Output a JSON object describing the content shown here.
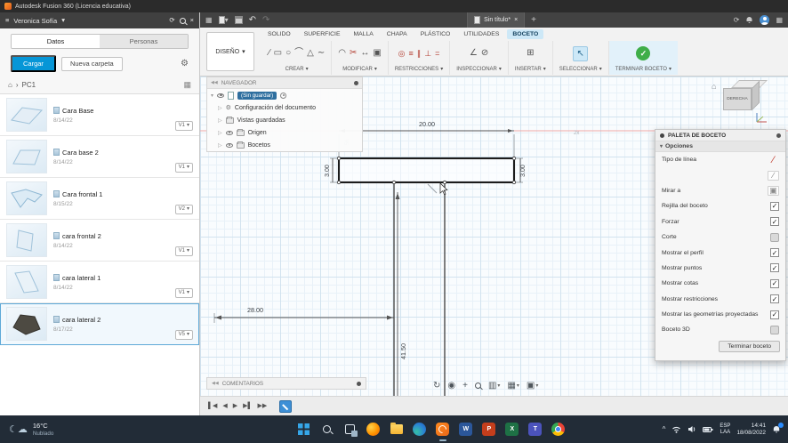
{
  "glyphs": {
    "caret_down": "▾",
    "expand": "▷",
    "collapse": "▾",
    "menu": "≡",
    "refresh": "⟳",
    "gear": "⚙",
    "home": "⌂",
    "chevron_right": "›",
    "close": "×",
    "plus": "+",
    "undo": "↶",
    "redo": "↷",
    "check": "✓",
    "grid": "▦",
    "collapse_panel": "«",
    "chevron_up": "^",
    "back2": "◀◀"
  },
  "title_bar": {
    "title": "Autodesk Fusion 360 (Licencia educativa)"
  },
  "data_panel": {
    "user": "Veronica Sofía",
    "tabs": [
      {
        "label": "Datos"
      },
      {
        "label": "Personas"
      }
    ],
    "upload_button": "Cargar",
    "new_folder_button": "Nueva carpeta",
    "breadcrumb_root": "PC1",
    "items": [
      {
        "name": "Cara Base",
        "date": "8/14/22",
        "version": "V1"
      },
      {
        "name": "Cara base 2",
        "date": "8/14/22",
        "version": "V1"
      },
      {
        "name": "Cara frontal 1",
        "date": "8/15/22",
        "version": "V2"
      },
      {
        "name": "cara frontal 2",
        "date": "8/14/22",
        "version": "V1"
      },
      {
        "name": "cara lateral 1",
        "date": "8/14/22",
        "version": "V1"
      },
      {
        "name": "cara lateral 2",
        "date": "8/17/22",
        "version": "V5",
        "selected": true
      }
    ]
  },
  "app_bar": {
    "document_tab": "Sin título*"
  },
  "ribbon": {
    "workspace": "DISEÑO",
    "tabs": [
      "SOLIDO",
      "SUPERFICIE",
      "MALLA",
      "CHAPA",
      "PLÁSTICO",
      "UTILIDADES",
      "BOCETO"
    ],
    "active_tab": "BOCETO",
    "group_labels": [
      "CREAR",
      "MODIFICAR",
      "RESTRICCIONES",
      "INSPECCIONAR",
      "INSERTAR",
      "SELECCIONAR",
      "TERMINAR BOCETO"
    ],
    "create_icons": [
      {
        "g": "∕"
      },
      {
        "g": "▭"
      },
      {
        "g": "○"
      },
      {
        "g": "⌒"
      },
      {
        "g": "△"
      },
      {
        "g": "∼"
      }
    ],
    "modify_icons": [
      {
        "g": "◠"
      },
      {
        "g": "✂"
      },
      {
        "g": "↔"
      },
      {
        "g": "▣"
      }
    ],
    "constraint_icons": [
      {
        "g": "◎"
      },
      {
        "g": "≡"
      },
      {
        "g": "∥"
      },
      {
        "g": "⊥"
      },
      {
        "g": "="
      }
    ],
    "inspect_icons": [
      {
        "g": "∠"
      },
      {
        "g": "⊘"
      }
    ],
    "insert_icons": [
      {
        "g": "⊞"
      }
    ],
    "select_icon": "↖"
  },
  "navigator": {
    "title": "NAVEGADOR",
    "root_badge": "(Sin guardar)",
    "items": [
      {
        "label": "Configuración del documento"
      },
      {
        "label": "Vistas guardadas"
      },
      {
        "label": "Origen"
      },
      {
        "label": "Bocetos"
      }
    ]
  },
  "canvas": {
    "dimensions": {
      "top": "20.00",
      "left": "3.00",
      "right": "3.00",
      "small_rotated": "56",
      "faded": "2x",
      "horizontal": "28.00",
      "vertical": "41.50"
    },
    "viewcube_label": "DERECHA",
    "navbar_icons": [
      {
        "g": "↻"
      },
      {
        "g": "◉"
      },
      {
        "g": "+"
      }
    ],
    "navbar_dropdown_icons": [
      {
        "g": "▥"
      },
      {
        "g": "▦"
      },
      {
        "g": "▣"
      }
    ]
  },
  "comments_panel": {
    "title": "COMENTARIOS"
  },
  "sketch_palette": {
    "title": "PALETA DE BOCETO",
    "section": "Opciones",
    "rows": [
      {
        "label": "Tipo de línea"
      },
      {
        "label": ""
      },
      {
        "label": "Mirar a"
      },
      {
        "label": "Rejilla del boceto",
        "checked": true
      },
      {
        "label": "Forzar",
        "checked": true
      },
      {
        "label": "Corte",
        "checked": false
      },
      {
        "label": "Mostrar el perfil",
        "checked": true
      },
      {
        "label": "Mostrar puntos",
        "checked": true
      },
      {
        "label": "Mostrar cotas",
        "checked": true
      },
      {
        "label": "Mostrar restricciones",
        "checked": true
      },
      {
        "label": "Mostrar las geometrías proyectadas",
        "checked": true
      },
      {
        "label": "Boceto 3D",
        "checked": false
      }
    ],
    "finish_button": "Terminar boceto"
  },
  "timeline": {
    "controls": [
      {
        "g": "▌◀"
      },
      {
        "g": "◀"
      },
      {
        "g": "▶"
      },
      {
        "g": "▶▌"
      },
      {
        "g": "▶▶"
      }
    ]
  },
  "taskbar": {
    "weather": {
      "temp": "16°C",
      "desc": "Nublado"
    },
    "apps": [
      {
        "name": "start"
      },
      {
        "name": "search"
      },
      {
        "name": "task-view"
      },
      {
        "name": "firefox"
      },
      {
        "name": "file-explorer"
      },
      {
        "name": "edge"
      },
      {
        "name": "fusion-360",
        "active": true
      },
      {
        "name": "word",
        "glyph": "W"
      },
      {
        "name": "powerpoint",
        "glyph": "P"
      },
      {
        "name": "excel",
        "glyph": "X"
      },
      {
        "name": "teams",
        "glyph": "T"
      },
      {
        "name": "chrome"
      }
    ],
    "tray": {
      "language_line1": "ESP",
      "language_line2": "LAA",
      "time": "14:41",
      "date": "18/08/2022"
    }
  }
}
